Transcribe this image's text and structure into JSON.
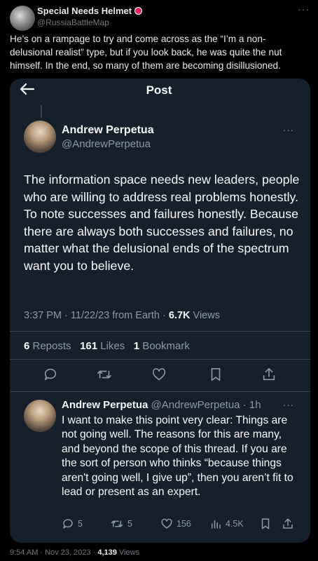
{
  "outer": {
    "author_name": "Special Needs Helmet",
    "author_handle": "@RussiaBattleMap",
    "text": "He’s on a rampage to try and come across as the “I’m a non-delusional realist” type, but if you look back, he was quite the nut himself. In the end, so many of them are becoming disillusioned.",
    "more": "···"
  },
  "card": {
    "header_title": "Post",
    "post": {
      "author_name": "Andrew Perpetua",
      "author_handle": "@AndrewPerpetua",
      "more": "···",
      "text": "The information space needs new leaders, people who are willing to address real problems honestly. To note successes and failures honestly. Because there are always both successes and failures, no matter what the delusional ends of the spectrum want you to believe.",
      "time": "3:37 PM · 11/22/23 from Earth · ",
      "views_count": "6.7K",
      "views_label": " Views",
      "reposts_count": "6",
      "reposts_label": " Reposts",
      "likes_count": "161",
      "likes_label": " Likes",
      "bookmarks_count": "1",
      "bookmarks_label": " Bookmark"
    },
    "reply": {
      "author_name": "Andrew Perpetua",
      "author_handle": "@AndrewPerpetua",
      "time": " · 1h",
      "more": "···",
      "text": "I want to make this point very clear: Things are not going well. The reasons for this are many, and beyond the scope of this thread. If you are the sort of person who thinks “because things aren't going well, I give up”, then you aren’t fit to lead or present as an expert.",
      "replies": "5",
      "reposts": "5",
      "likes": "156",
      "views": "4.5K"
    }
  },
  "footer": {
    "timestamp": "9:54 AM · Nov 23, 2023 · ",
    "views_count": "4,139",
    "views_label": " Views"
  },
  "colors": {
    "card_bg": "#15202b",
    "page_bg": "#000000",
    "muted": "#8b98a5",
    "badge": "#e0245e"
  }
}
